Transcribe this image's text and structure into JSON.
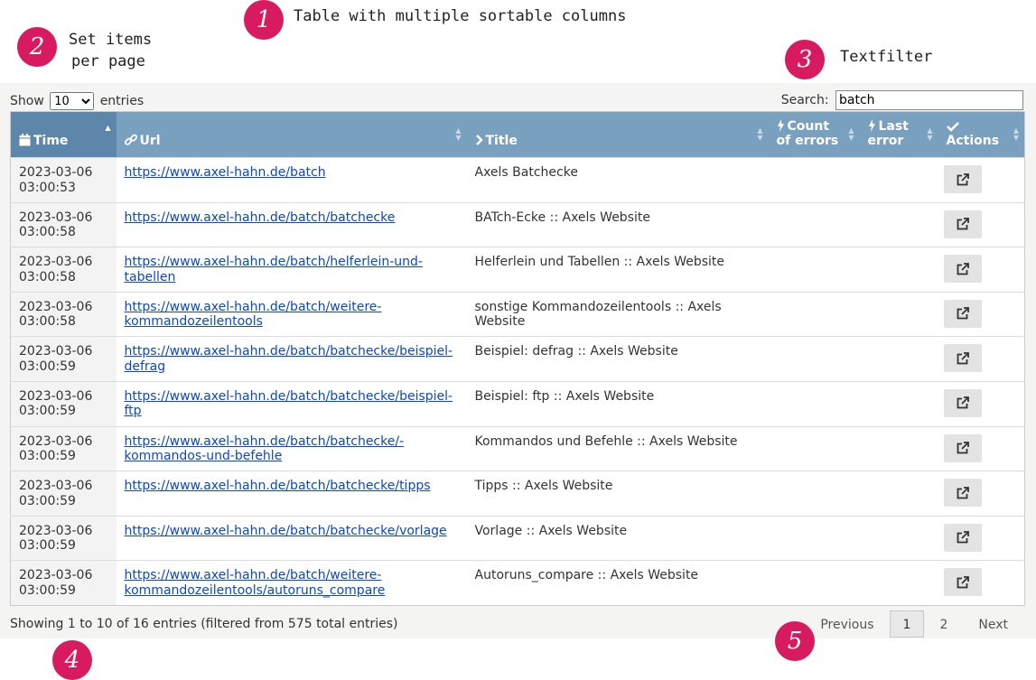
{
  "annotations": {
    "n1": "1",
    "t1": "Table with multiple sortable columns",
    "n2": "2",
    "t2a": "Set items",
    "t2b": "per page",
    "n3": "3",
    "t3": "Textfilter",
    "n4": "4",
    "n5": "5"
  },
  "controls": {
    "show_label": "Show",
    "entries_label": "entries",
    "page_size": "10",
    "search_label": "Search:",
    "search_value": "batch"
  },
  "columns": [
    {
      "label": "Time",
      "icon": "calendar-icon"
    },
    {
      "label": "Url",
      "icon": "link-icon"
    },
    {
      "label": "Title",
      "icon": "chevron-right-icon"
    },
    {
      "label": "Count of errors",
      "icon": "bolt-icon"
    },
    {
      "label": "Last error",
      "icon": "bolt-icon"
    },
    {
      "label": "Actions",
      "icon": "check-icon"
    }
  ],
  "rows": [
    {
      "date": "2023-03-06",
      "time": "03:00:53",
      "url": "https://www.axel-hahn.de/batch",
      "title": "Axels Batchecke"
    },
    {
      "date": "2023-03-06",
      "time": "03:00:58",
      "url": "https://www.axel-hahn.de/batch/batchecke",
      "title": "BATch-Ecke :: Axels Website"
    },
    {
      "date": "2023-03-06",
      "time": "03:00:58",
      "url": "https://www.axel-hahn.de/batch/helferlein-und-tabellen",
      "title": "Helferlein und Tabellen :: Axels Website"
    },
    {
      "date": "2023-03-06",
      "time": "03:00:58",
      "url": "https://www.axel-hahn.de/batch/weitere-kommandozeilentools",
      "title": "sonstige Kommandozeilentools :: Axels Website"
    },
    {
      "date": "2023-03-06",
      "time": "03:00:59",
      "url": "https://www.axel-hahn.de/batch/batchecke/beispiel-defrag",
      "title": "Beispiel: defrag :: Axels Website"
    },
    {
      "date": "2023-03-06",
      "time": "03:00:59",
      "url": "https://www.axel-hahn.de/batch/batchecke/beispiel-ftp",
      "title": "Beispiel: ftp :: Axels Website"
    },
    {
      "date": "2023-03-06",
      "time": "03:00:59",
      "url": "https://www.axel-hahn.de/batch/batchecke/-kommandos-und-befehle",
      "title": "Kommandos und Befehle :: Axels Website"
    },
    {
      "date": "2023-03-06",
      "time": "03:00:59",
      "url": "https://www.axel-hahn.de/batch/batchecke/tipps",
      "title": "Tipps :: Axels Website"
    },
    {
      "date": "2023-03-06",
      "time": "03:00:59",
      "url": "https://www.axel-hahn.de/batch/batchecke/vorlage",
      "title": "Vorlage :: Axels Website"
    },
    {
      "date": "2023-03-06",
      "time": "03:00:59",
      "url": "https://www.axel-hahn.de/batch/weitere-kommandozeilentools/autoruns_compare",
      "title": "Autoruns_compare :: Axels Website"
    }
  ],
  "footer": {
    "info": "Showing 1 to 10 of 16 entries (filtered from 575 total entries)",
    "previous": "Previous",
    "page1": "1",
    "page2": "2",
    "next": "Next"
  },
  "colors": {
    "header_bg": "#7aa0c0",
    "header_sorted_bg": "#5d86ab",
    "link": "#0a47c9",
    "annotation_bubble": "#d81b60"
  }
}
